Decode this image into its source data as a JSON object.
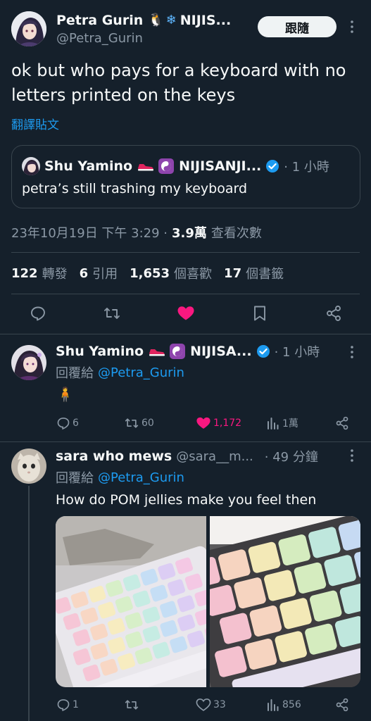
{
  "main_tweet": {
    "display_name": "Petra Gurin",
    "name_suffix": "NIJIS...",
    "handle": "@Petra_Gurin",
    "follow_label": "跟隨",
    "text_line1": "ok but who pays for a keyboard with no",
    "text_line2": "letters printed on the keys",
    "translate_label": "翻譯貼文",
    "quote": {
      "display_name": "Shu Yamino",
      "name_suffix": "NIJISANJI...",
      "time": "· 1 小時",
      "text": "petra’s still trashing my keyboard"
    },
    "timestamp": "23年10月19日 下午 3:29 ·",
    "views_count": "3.9萬",
    "views_label": "查看次數",
    "stats": {
      "reposts_count": "122",
      "reposts_label": "轉發",
      "quotes_count": "6",
      "quotes_label": "引用",
      "likes_count": "1,653",
      "likes_label": "個喜歡",
      "bookmarks_count": "17",
      "bookmarks_label": "個書籤"
    }
  },
  "reply1": {
    "display_name": "Shu Yamino",
    "name_suffix": "NIJISA...",
    "time": "· 1 小時",
    "reply_to_label": "回覆給",
    "reply_to_handle": "@Petra_Gurin",
    "text": "🧍",
    "actions": {
      "replies": "6",
      "reposts": "60",
      "likes": "1,172",
      "views": "1萬"
    }
  },
  "reply2": {
    "display_name": "sara who mews",
    "handle": "@sara__m...",
    "time": "· 49 分鐘",
    "reply_to_label": "回覆給",
    "reply_to_handle": "@Petra_Gurin",
    "text": "How do POM jellies make you feel then",
    "actions": {
      "replies": "1",
      "reposts": "",
      "likes": "33",
      "views": "856"
    }
  },
  "colors": {
    "background": "#15202b",
    "accent": "#1d9bf0",
    "like": "#f91880",
    "muted": "#8b98a5"
  }
}
